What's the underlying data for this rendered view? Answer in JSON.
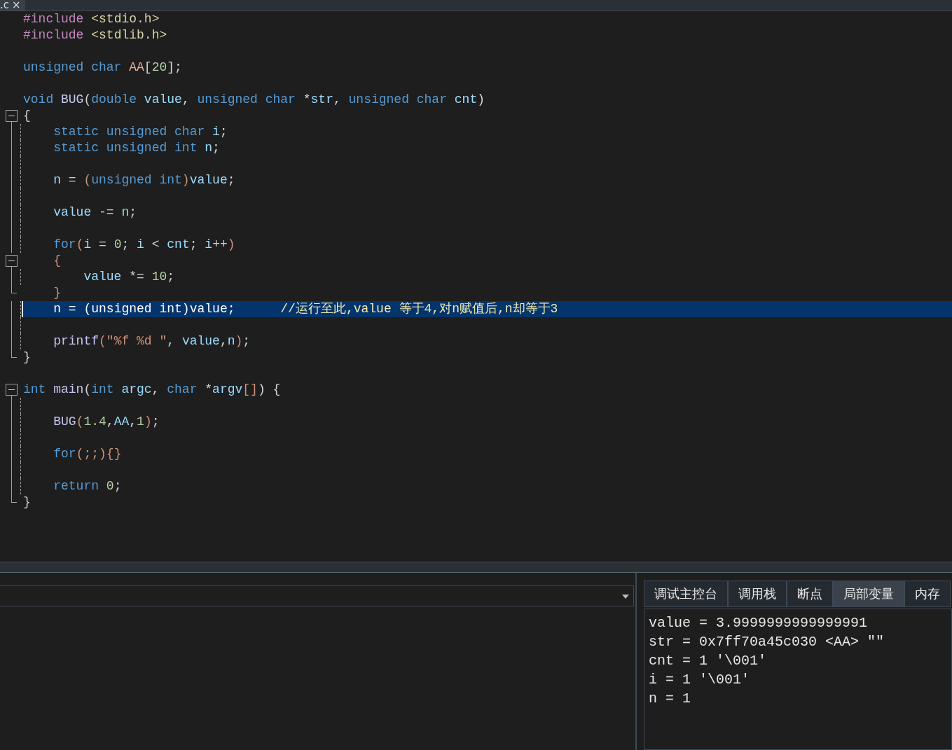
{
  "editor_tab": {
    "label": ".c",
    "close": "×"
  },
  "code_lines": [
    {
      "kind": "none",
      "current": false,
      "tokens": [
        {
          "t": "#include",
          "kind": "pp"
        },
        {
          "t": " <stdio.h>",
          "kind": "inc"
        }
      ]
    },
    {
      "kind": "none",
      "current": false,
      "tokens": [
        {
          "t": "#include",
          "kind": "pp"
        },
        {
          "t": " <stdlib.h>",
          "kind": "inc"
        }
      ]
    },
    {
      "kind": "none",
      "current": false
    },
    {
      "kind": "none",
      "current": false,
      "tokens": [
        {
          "t": "unsigned char",
          "kind": "kw"
        },
        {
          "t": " AA",
          "kind": "gl"
        },
        {
          "t": "[",
          "kind": "p"
        },
        {
          "t": "20",
          "kind": "num"
        },
        {
          "t": "];",
          "kind": "p"
        }
      ]
    },
    {
      "kind": "none",
      "current": false
    },
    {
      "kind": "none",
      "current": false,
      "tokens": [
        {
          "t": "void",
          "kind": "kw"
        },
        {
          "t": " BUG",
          "kind": "fn"
        },
        {
          "t": "(",
          "kind": "p"
        },
        {
          "t": "double",
          "kind": "kw"
        },
        {
          "t": " value",
          "kind": "var"
        },
        {
          "t": ", ",
          "kind": "p"
        },
        {
          "t": "unsigned char",
          "kind": "kw"
        },
        {
          "t": " *",
          "kind": "p"
        },
        {
          "t": "str",
          "kind": "var"
        },
        {
          "t": ", ",
          "kind": "p"
        },
        {
          "t": "unsigned char",
          "kind": "kw"
        },
        {
          "t": " cnt",
          "kind": "var"
        },
        {
          "t": ")",
          "kind": "p"
        }
      ]
    },
    {
      "kind": "open",
      "current": false,
      "tokens": [
        {
          "t": "{",
          "kind": "p"
        }
      ]
    },
    {
      "kind": "mid",
      "current": false,
      "tokens": [
        {
          "t": "    static unsigned char",
          "kind": "kw"
        },
        {
          "t": " i",
          "kind": "var"
        },
        {
          "t": ";",
          "kind": "p"
        }
      ]
    },
    {
      "kind": "mid",
      "current": false,
      "tokens": [
        {
          "t": "    static unsigned int",
          "kind": "kw"
        },
        {
          "t": " n",
          "kind": "var"
        },
        {
          "t": ";",
          "kind": "p"
        }
      ]
    },
    {
      "kind": "mid",
      "current": false
    },
    {
      "kind": "mid",
      "current": false,
      "tokens": [
        {
          "t": "    n",
          "kind": "var"
        },
        {
          "t": " = ",
          "kind": "p"
        },
        {
          "t": "(",
          "kind": "par"
        },
        {
          "t": "unsigned int",
          "kind": "kw"
        },
        {
          "t": ")",
          "kind": "par"
        },
        {
          "t": "value",
          "kind": "var"
        },
        {
          "t": ";",
          "kind": "p"
        }
      ]
    },
    {
      "kind": "mid",
      "current": false
    },
    {
      "kind": "mid",
      "current": false,
      "tokens": [
        {
          "t": "    value",
          "kind": "var"
        },
        {
          "t": " -= ",
          "kind": "p"
        },
        {
          "t": "n",
          "kind": "var"
        },
        {
          "t": ";",
          "kind": "p"
        }
      ]
    },
    {
      "kind": "mid",
      "current": false
    },
    {
      "kind": "mid",
      "current": false,
      "tokens": [
        {
          "t": "    for",
          "kind": "kw"
        },
        {
          "t": "(",
          "kind": "par"
        },
        {
          "t": "i",
          "kind": "var"
        },
        {
          "t": " = ",
          "kind": "p"
        },
        {
          "t": "0",
          "kind": "num"
        },
        {
          "t": "; ",
          "kind": "p"
        },
        {
          "t": "i",
          "kind": "var"
        },
        {
          "t": " < ",
          "kind": "p"
        },
        {
          "t": "cnt",
          "kind": "var"
        },
        {
          "t": "; ",
          "kind": "p"
        },
        {
          "t": "i",
          "kind": "var"
        },
        {
          "t": "++",
          "kind": "p"
        },
        {
          "t": ")",
          "kind": "par"
        }
      ]
    },
    {
      "kind": "open",
      "current": false,
      "tokens": [
        {
          "t": "    {",
          "kind": "par"
        }
      ]
    },
    {
      "kind": "mid",
      "current": false,
      "tokens": [
        {
          "t": "        value",
          "kind": "var"
        },
        {
          "t": " *= ",
          "kind": "p"
        },
        {
          "t": "10",
          "kind": "num"
        },
        {
          "t": ";",
          "kind": "p"
        }
      ]
    },
    {
      "kind": "end",
      "current": false,
      "tokens": [
        {
          "t": "    }",
          "kind": "par"
        }
      ]
    },
    {
      "kind": "mid",
      "current": true,
      "tokens": [
        {
          "t": "    n",
          "kind": "var"
        },
        {
          "t": " = ",
          "kind": "p"
        },
        {
          "t": "(",
          "kind": "par"
        },
        {
          "t": "unsigned int",
          "kind": "kw"
        },
        {
          "t": ")",
          "kind": "par"
        },
        {
          "t": "value",
          "kind": "var"
        },
        {
          "t": ";",
          "kind": "p"
        },
        {
          "t": "      //运行至此,value 等于4,对n赋值后,n却等于3",
          "kind": "cm"
        }
      ]
    },
    {
      "kind": "mid",
      "current": false
    },
    {
      "kind": "mid",
      "current": false,
      "tokens": [
        {
          "t": "    printf",
          "kind": "fn"
        },
        {
          "t": "(",
          "kind": "par"
        },
        {
          "t": "\"%f %d \"",
          "kind": "str"
        },
        {
          "t": ", ",
          "kind": "p"
        },
        {
          "t": "value",
          "kind": "var"
        },
        {
          "t": ",",
          "kind": "p"
        },
        {
          "t": "n",
          "kind": "var"
        },
        {
          "t": ")",
          "kind": "par"
        },
        {
          "t": ";",
          "kind": "p"
        }
      ]
    },
    {
      "kind": "end",
      "current": false,
      "tokens": [
        {
          "t": "}",
          "kind": "p"
        }
      ]
    },
    {
      "kind": "none",
      "current": false
    },
    {
      "kind": "open",
      "current": false,
      "tokens": [
        {
          "t": "int",
          "kind": "kw"
        },
        {
          "t": " main",
          "kind": "fn"
        },
        {
          "t": "(",
          "kind": "p"
        },
        {
          "t": "int",
          "kind": "kw"
        },
        {
          "t": " argc",
          "kind": "var"
        },
        {
          "t": ", ",
          "kind": "p"
        },
        {
          "t": "char",
          "kind": "kw"
        },
        {
          "t": " *",
          "kind": "p"
        },
        {
          "t": "argv",
          "kind": "var"
        },
        {
          "t": "[]",
          "kind": "par"
        },
        {
          "t": ") {",
          "kind": "p"
        }
      ]
    },
    {
      "kind": "mid",
      "current": false
    },
    {
      "kind": "mid",
      "current": false,
      "tokens": [
        {
          "t": "    BUG",
          "kind": "fn"
        },
        {
          "t": "(",
          "kind": "par"
        },
        {
          "t": "1.4",
          "kind": "num"
        },
        {
          "t": ",",
          "kind": "p"
        },
        {
          "t": "AA",
          "kind": "var"
        },
        {
          "t": ",",
          "kind": "p"
        },
        {
          "t": "1",
          "kind": "num"
        },
        {
          "t": ")",
          "kind": "par"
        },
        {
          "t": ";",
          "kind": "p"
        }
      ]
    },
    {
      "kind": "mid",
      "current": false
    },
    {
      "kind": "mid",
      "current": false,
      "tokens": [
        {
          "t": "    for",
          "kind": "kw"
        },
        {
          "t": "(;;){}",
          "kind": "par"
        }
      ]
    },
    {
      "kind": "mid",
      "current": false
    },
    {
      "kind": "mid",
      "current": false,
      "tokens": [
        {
          "t": "    return",
          "kind": "kw"
        },
        {
          "t": " 0",
          "kind": "num"
        },
        {
          "t": ";",
          "kind": "p"
        }
      ]
    },
    {
      "kind": "end",
      "current": false,
      "tokens": [
        {
          "t": "}",
          "kind": "p"
        }
      ]
    }
  ],
  "debug_tabs": [
    {
      "label": "调试主控台",
      "selected": false
    },
    {
      "label": "调用栈",
      "selected": false
    },
    {
      "label": "断点",
      "selected": false
    },
    {
      "label": "局部变量",
      "selected": true
    },
    {
      "label": "内存",
      "selected": false
    }
  ],
  "locals": [
    "value = 3.9999999999999991",
    "str = 0x7ff70a45c030 <AA> \"\"",
    "cnt = 1 '\\001'",
    "i = 1 '\\001'",
    "n = 1"
  ]
}
